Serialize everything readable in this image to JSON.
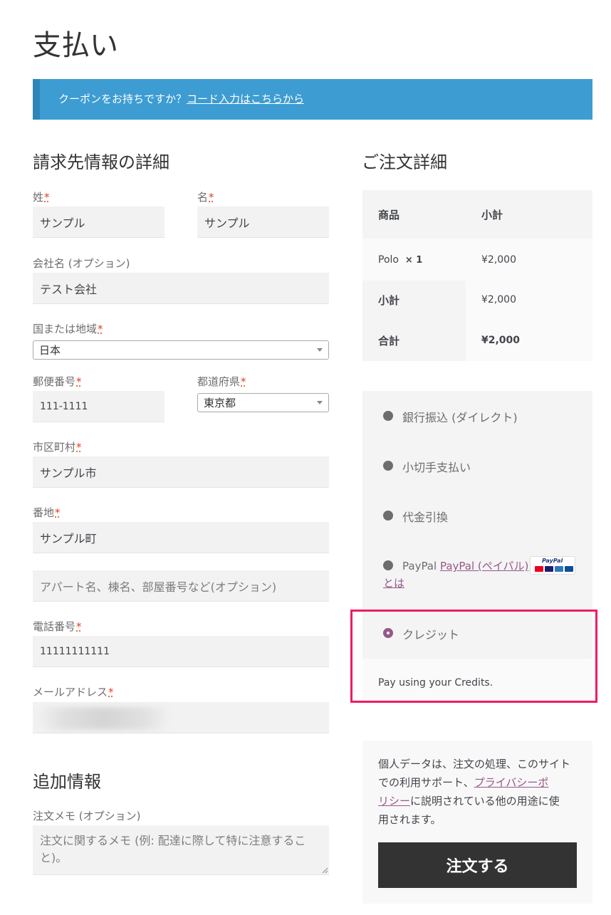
{
  "page": {
    "title": "支払い"
  },
  "coupon": {
    "prompt": "クーポンをお持ちですか？",
    "link": "コード入力はこちらから"
  },
  "billing": {
    "heading": "請求先情報の詳細",
    "last_name": {
      "label": "姓",
      "value": "サンプル"
    },
    "first_name": {
      "label": "名",
      "value": "サンプル"
    },
    "company": {
      "label": "会社名 (オプション)",
      "value": "テスト会社"
    },
    "country": {
      "label": "国または地域",
      "value": "日本"
    },
    "postcode": {
      "label": "郵便番号",
      "value": "111-1111"
    },
    "state": {
      "label": "都道府県",
      "value": "東京都"
    },
    "city": {
      "label": "市区町村",
      "value": "サンプル市"
    },
    "address1": {
      "label": "番地",
      "value": "サンプル町"
    },
    "address2": {
      "placeholder": "アパート名、棟名、部屋番号など(オプション)"
    },
    "phone": {
      "label": "電話番号",
      "value": "11111111111"
    },
    "email": {
      "label": "メールアドレス"
    },
    "required_mark": "*"
  },
  "additional": {
    "heading": "追加情報",
    "notes": {
      "label": "注文メモ (オプション)",
      "placeholder": "注文に関するメモ (例: 配達に際して特に注意すること)。"
    }
  },
  "order": {
    "heading": "ご注文詳細",
    "col_product": "商品",
    "col_subtotal": "小計",
    "item": {
      "name": "Polo",
      "qty": "× 1",
      "price": "¥2,000"
    },
    "subtotal": {
      "label": "小計",
      "value": "¥2,000"
    },
    "total": {
      "label": "合計",
      "value": "¥2,000"
    }
  },
  "payment": {
    "methods": [
      {
        "label": "銀行振込 (ダイレクト)"
      },
      {
        "label": "小切手支払い"
      },
      {
        "label": "代金引換"
      },
      {
        "label": "PayPal",
        "link_line1": "PayPal (ペイパル)",
        "link_line2": "とは"
      },
      {
        "label": "クレジット"
      }
    ],
    "selected_description": "Pay using your Credits.",
    "paypal_logo_text": "PayPal"
  },
  "privacy": {
    "line1": "個人データは、注文の処理、このサイ",
    "line1_end": "ト",
    "line2_pre": "での利用サポート、",
    "link_line2": "プライバシーポ",
    "link_line3": "リシー",
    "line3_post": "に説明されている他の用途に使",
    "line4": "用されます。"
  },
  "place_order": {
    "label": "注文する"
  },
  "colors": {
    "accent": "#3d9cd2",
    "purple": "#96588a",
    "highlight": "#ef1c63",
    "button": "#333333"
  }
}
